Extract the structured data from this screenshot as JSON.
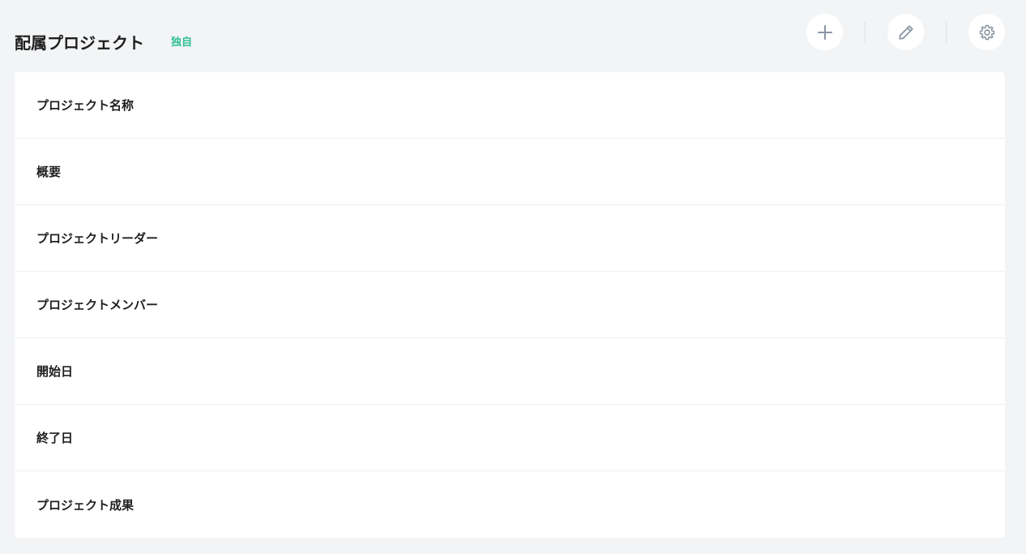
{
  "header": {
    "title": "配属プロジェクト",
    "badge": "独自"
  },
  "toolbar": {
    "buttons": [
      {
        "icon": "plus-icon"
      },
      {
        "icon": "pencil-icon"
      },
      {
        "icon": "gear-icon"
      }
    ]
  },
  "fields": [
    {
      "label": "プロジェクト名称"
    },
    {
      "label": "概要"
    },
    {
      "label": "プロジェクトリーダー"
    },
    {
      "label": "プロジェクトメンバー"
    },
    {
      "label": "開始日"
    },
    {
      "label": "終了日"
    },
    {
      "label": "プロジェクト成果"
    }
  ],
  "colors": {
    "background": "#f3f4f6",
    "card": "#ffffff",
    "badge": "#2fbf95",
    "icon": "#8a96a3"
  }
}
